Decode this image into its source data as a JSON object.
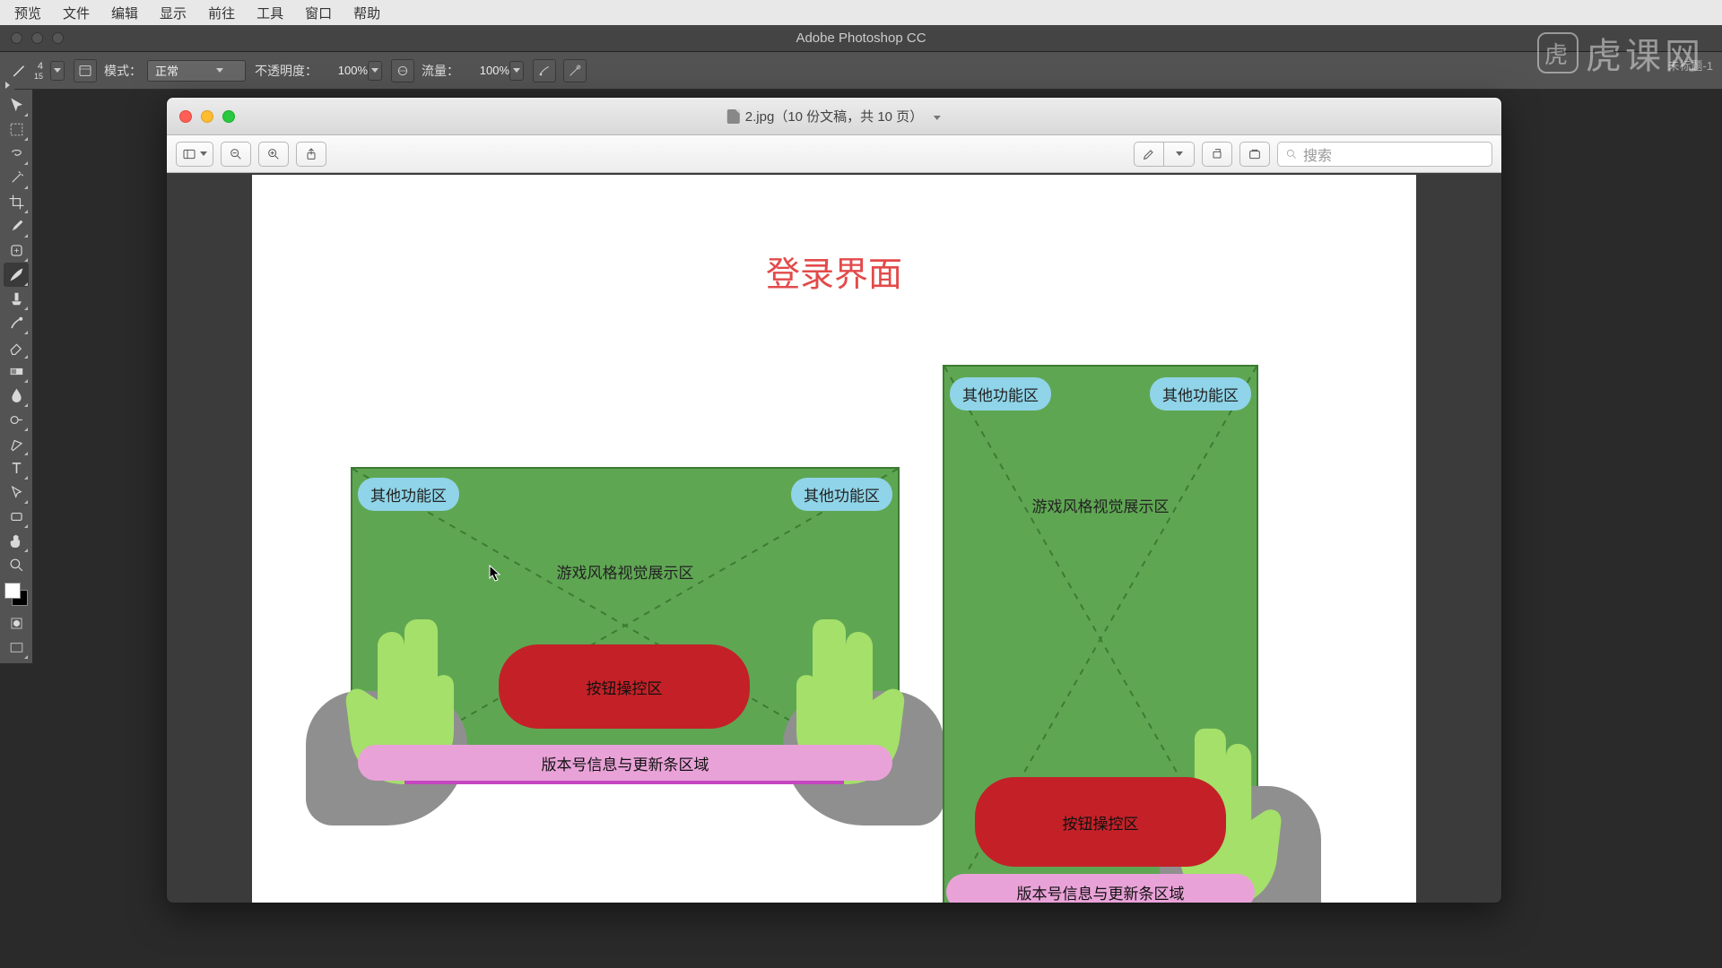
{
  "menubar": [
    "预览",
    "文件",
    "编辑",
    "显示",
    "前往",
    "工具",
    "窗口",
    "帮助"
  ],
  "app_title": "Adobe Photoshop CC",
  "doc_tab": "未标题-1",
  "options": {
    "size_num": "4",
    "size_sub": "15",
    "mode_label": "模式：",
    "mode_value": "正常",
    "opacity_label": "不透明度：",
    "opacity_value": "100%",
    "flow_label": "流量：",
    "flow_value": "100%"
  },
  "finder": {
    "title": "2.jpg（10 份文稿，共 10 页）",
    "search_placeholder": "搜索"
  },
  "page": {
    "title": "登录界面",
    "other_zone": "其他功能区",
    "visual_zone": "游戏风格视觉展示区",
    "button_zone": "按钮操控区",
    "version_zone": "版本号信息与更新条区域"
  },
  "watermark": "虎课网"
}
